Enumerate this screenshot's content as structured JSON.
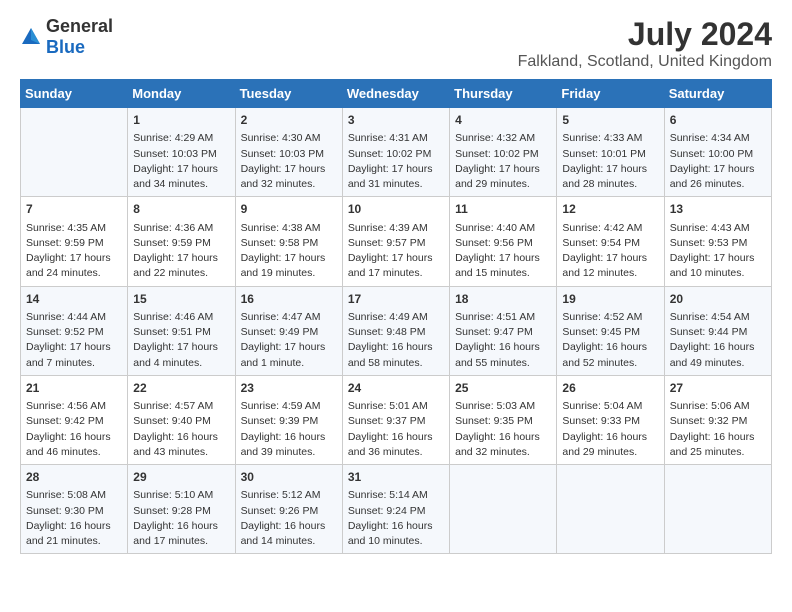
{
  "logo": {
    "general": "General",
    "blue": "Blue"
  },
  "title": "July 2024",
  "subtitle": "Falkland, Scotland, United Kingdom",
  "days_of_week": [
    "Sunday",
    "Monday",
    "Tuesday",
    "Wednesday",
    "Thursday",
    "Friday",
    "Saturday"
  ],
  "weeks": [
    [
      {
        "day": "",
        "info": ""
      },
      {
        "day": "1",
        "info": "Sunrise: 4:29 AM\nSunset: 10:03 PM\nDaylight: 17 hours and 34 minutes."
      },
      {
        "day": "2",
        "info": "Sunrise: 4:30 AM\nSunset: 10:03 PM\nDaylight: 17 hours and 32 minutes."
      },
      {
        "day": "3",
        "info": "Sunrise: 4:31 AM\nSunset: 10:02 PM\nDaylight: 17 hours and 31 minutes."
      },
      {
        "day": "4",
        "info": "Sunrise: 4:32 AM\nSunset: 10:02 PM\nDaylight: 17 hours and 29 minutes."
      },
      {
        "day": "5",
        "info": "Sunrise: 4:33 AM\nSunset: 10:01 PM\nDaylight: 17 hours and 28 minutes."
      },
      {
        "day": "6",
        "info": "Sunrise: 4:34 AM\nSunset: 10:00 PM\nDaylight: 17 hours and 26 minutes."
      }
    ],
    [
      {
        "day": "7",
        "info": "Sunrise: 4:35 AM\nSunset: 9:59 PM\nDaylight: 17 hours and 24 minutes."
      },
      {
        "day": "8",
        "info": "Sunrise: 4:36 AM\nSunset: 9:59 PM\nDaylight: 17 hours and 22 minutes."
      },
      {
        "day": "9",
        "info": "Sunrise: 4:38 AM\nSunset: 9:58 PM\nDaylight: 17 hours and 19 minutes."
      },
      {
        "day": "10",
        "info": "Sunrise: 4:39 AM\nSunset: 9:57 PM\nDaylight: 17 hours and 17 minutes."
      },
      {
        "day": "11",
        "info": "Sunrise: 4:40 AM\nSunset: 9:56 PM\nDaylight: 17 hours and 15 minutes."
      },
      {
        "day": "12",
        "info": "Sunrise: 4:42 AM\nSunset: 9:54 PM\nDaylight: 17 hours and 12 minutes."
      },
      {
        "day": "13",
        "info": "Sunrise: 4:43 AM\nSunset: 9:53 PM\nDaylight: 17 hours and 10 minutes."
      }
    ],
    [
      {
        "day": "14",
        "info": "Sunrise: 4:44 AM\nSunset: 9:52 PM\nDaylight: 17 hours and 7 minutes."
      },
      {
        "day": "15",
        "info": "Sunrise: 4:46 AM\nSunset: 9:51 PM\nDaylight: 17 hours and 4 minutes."
      },
      {
        "day": "16",
        "info": "Sunrise: 4:47 AM\nSunset: 9:49 PM\nDaylight: 17 hours and 1 minute."
      },
      {
        "day": "17",
        "info": "Sunrise: 4:49 AM\nSunset: 9:48 PM\nDaylight: 16 hours and 58 minutes."
      },
      {
        "day": "18",
        "info": "Sunrise: 4:51 AM\nSunset: 9:47 PM\nDaylight: 16 hours and 55 minutes."
      },
      {
        "day": "19",
        "info": "Sunrise: 4:52 AM\nSunset: 9:45 PM\nDaylight: 16 hours and 52 minutes."
      },
      {
        "day": "20",
        "info": "Sunrise: 4:54 AM\nSunset: 9:44 PM\nDaylight: 16 hours and 49 minutes."
      }
    ],
    [
      {
        "day": "21",
        "info": "Sunrise: 4:56 AM\nSunset: 9:42 PM\nDaylight: 16 hours and 46 minutes."
      },
      {
        "day": "22",
        "info": "Sunrise: 4:57 AM\nSunset: 9:40 PM\nDaylight: 16 hours and 43 minutes."
      },
      {
        "day": "23",
        "info": "Sunrise: 4:59 AM\nSunset: 9:39 PM\nDaylight: 16 hours and 39 minutes."
      },
      {
        "day": "24",
        "info": "Sunrise: 5:01 AM\nSunset: 9:37 PM\nDaylight: 16 hours and 36 minutes."
      },
      {
        "day": "25",
        "info": "Sunrise: 5:03 AM\nSunset: 9:35 PM\nDaylight: 16 hours and 32 minutes."
      },
      {
        "day": "26",
        "info": "Sunrise: 5:04 AM\nSunset: 9:33 PM\nDaylight: 16 hours and 29 minutes."
      },
      {
        "day": "27",
        "info": "Sunrise: 5:06 AM\nSunset: 9:32 PM\nDaylight: 16 hours and 25 minutes."
      }
    ],
    [
      {
        "day": "28",
        "info": "Sunrise: 5:08 AM\nSunset: 9:30 PM\nDaylight: 16 hours and 21 minutes."
      },
      {
        "day": "29",
        "info": "Sunrise: 5:10 AM\nSunset: 9:28 PM\nDaylight: 16 hours and 17 minutes."
      },
      {
        "day": "30",
        "info": "Sunrise: 5:12 AM\nSunset: 9:26 PM\nDaylight: 16 hours and 14 minutes."
      },
      {
        "day": "31",
        "info": "Sunrise: 5:14 AM\nSunset: 9:24 PM\nDaylight: 16 hours and 10 minutes."
      },
      {
        "day": "",
        "info": ""
      },
      {
        "day": "",
        "info": ""
      },
      {
        "day": "",
        "info": ""
      }
    ]
  ]
}
